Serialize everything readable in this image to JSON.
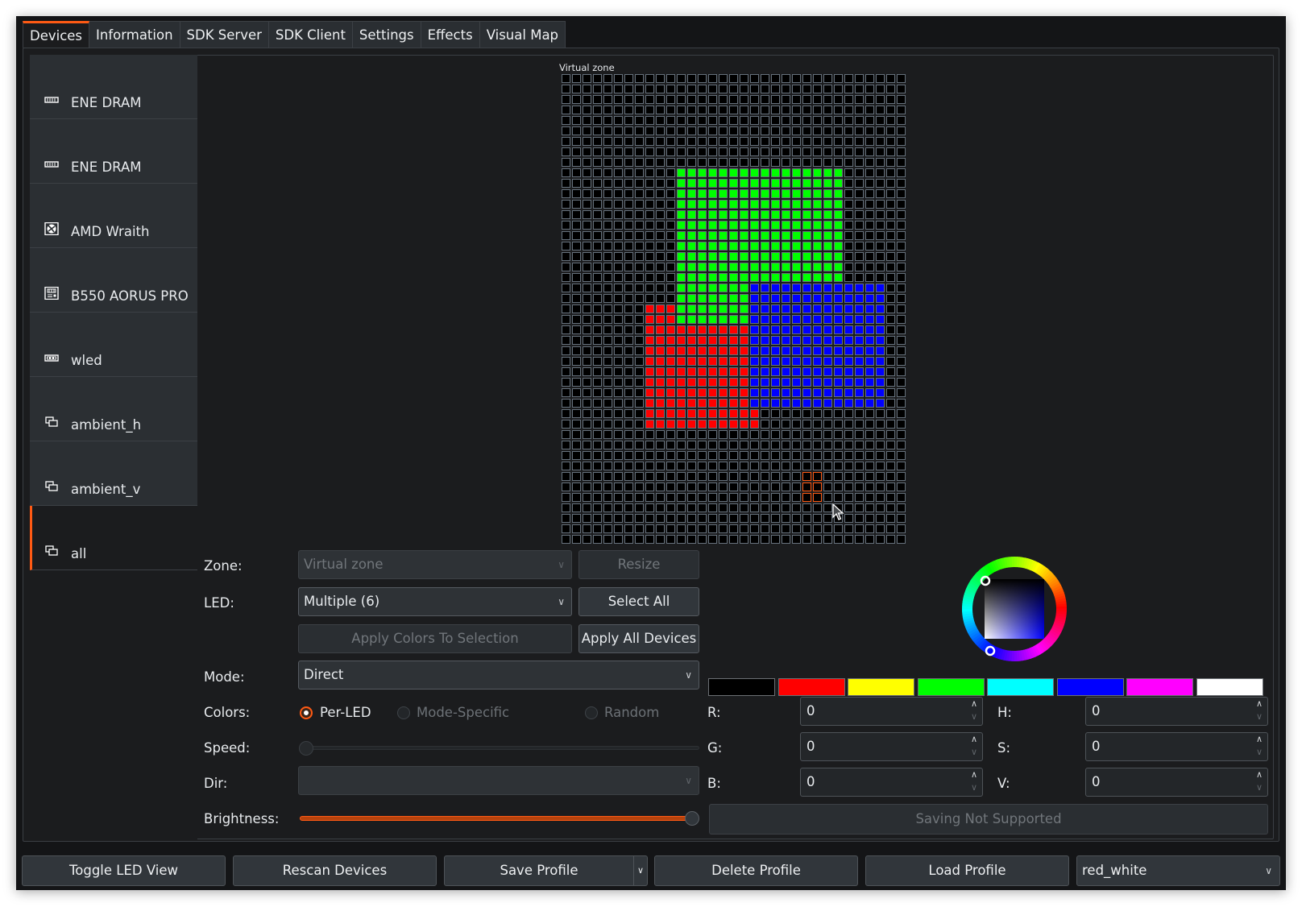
{
  "tabs": [
    {
      "label": "Devices",
      "active": true
    },
    {
      "label": "Information"
    },
    {
      "label": "SDK Server"
    },
    {
      "label": "SDK Client"
    },
    {
      "label": "Settings"
    },
    {
      "label": "Effects"
    },
    {
      "label": "Visual Map"
    }
  ],
  "devices": [
    {
      "label": "ENE DRAM",
      "icon": "ram-icon"
    },
    {
      "label": "ENE DRAM",
      "icon": "ram-icon"
    },
    {
      "label": "AMD Wraith",
      "icon": "fan-icon"
    },
    {
      "label": "B550 AORUS PRO",
      "icon": "motherboard-icon"
    },
    {
      "label": "wled",
      "icon": "ledstrip-icon"
    },
    {
      "label": "ambient_h",
      "icon": "virtual-device-icon"
    },
    {
      "label": "ambient_v",
      "icon": "virtual-device-icon"
    },
    {
      "label": "all",
      "icon": "virtual-device-icon",
      "selected": true
    }
  ],
  "led_view": {
    "zone_title": "Virtual zone",
    "grid": {
      "cols": 33,
      "rows": 45,
      "regions": [
        {
          "color": "#00ff00",
          "cols": [
            11,
            26
          ],
          "rows": [
            9,
            19
          ]
        },
        {
          "color": "#00ff00",
          "cols": [
            11,
            17
          ],
          "rows": [
            20,
            23
          ]
        },
        {
          "color": "#0000ff",
          "cols": [
            18,
            30
          ],
          "rows": [
            20,
            31
          ]
        },
        {
          "color": "#ff0000",
          "cols": [
            8,
            10
          ],
          "rows": [
            22,
            23
          ]
        },
        {
          "color": "#ff0000",
          "cols": [
            8,
            17
          ],
          "rows": [
            24,
            33
          ]
        },
        {
          "color": "#ff0000",
          "cols": [
            18,
            18
          ],
          "rows": [
            32,
            33
          ]
        }
      ],
      "selected_cells": {
        "cols": [
          23,
          24
        ],
        "rows": [
          38,
          40
        ]
      }
    }
  },
  "controls": {
    "zone_label": "Zone:",
    "zone_value": "Virtual zone",
    "resize_label": "Resize",
    "led_label": "LED:",
    "led_value": "Multiple (6)",
    "select_all_label": "Select All",
    "apply_selection_label": "Apply Colors To Selection",
    "apply_all_label": "Apply All Devices",
    "mode_label": "Mode:",
    "mode_value": "Direct",
    "colors_label": "Colors:",
    "color_modes": [
      {
        "label": "Per-LED",
        "checked": true,
        "enabled": true
      },
      {
        "label": "Mode-Specific",
        "checked": false,
        "enabled": false
      },
      {
        "label": "Random",
        "checked": false,
        "enabled": false
      }
    ],
    "speed_label": "Speed:",
    "speed_value": 0,
    "dir_label": "Dir:",
    "dir_value": "",
    "brightness_label": "Brightness:",
    "brightness_value": 1.0,
    "saving_label": "Saving Not Supported"
  },
  "color_picker": {
    "swatches": [
      "#000000",
      "#ff0000",
      "#ffff00",
      "#00ff00",
      "#00ffff",
      "#0000ff",
      "#ff00ff",
      "#ffffff"
    ],
    "fields": {
      "R": {
        "label": "R:",
        "value": "0"
      },
      "G": {
        "label": "G:",
        "value": "0"
      },
      "B": {
        "label": "B:",
        "value": "0"
      },
      "H": {
        "label": "H:",
        "value": "0"
      },
      "S": {
        "label": "S:",
        "value": "0"
      },
      "V": {
        "label": "V:",
        "value": "0"
      }
    }
  },
  "bottom_bar": {
    "toggle_led_view": "Toggle LED View",
    "rescan_devices": "Rescan Devices",
    "save_profile": "Save Profile",
    "delete_profile": "Delete Profile",
    "load_profile": "Load Profile",
    "profile_value": "red_white"
  },
  "accent_color": "#ff5a14"
}
